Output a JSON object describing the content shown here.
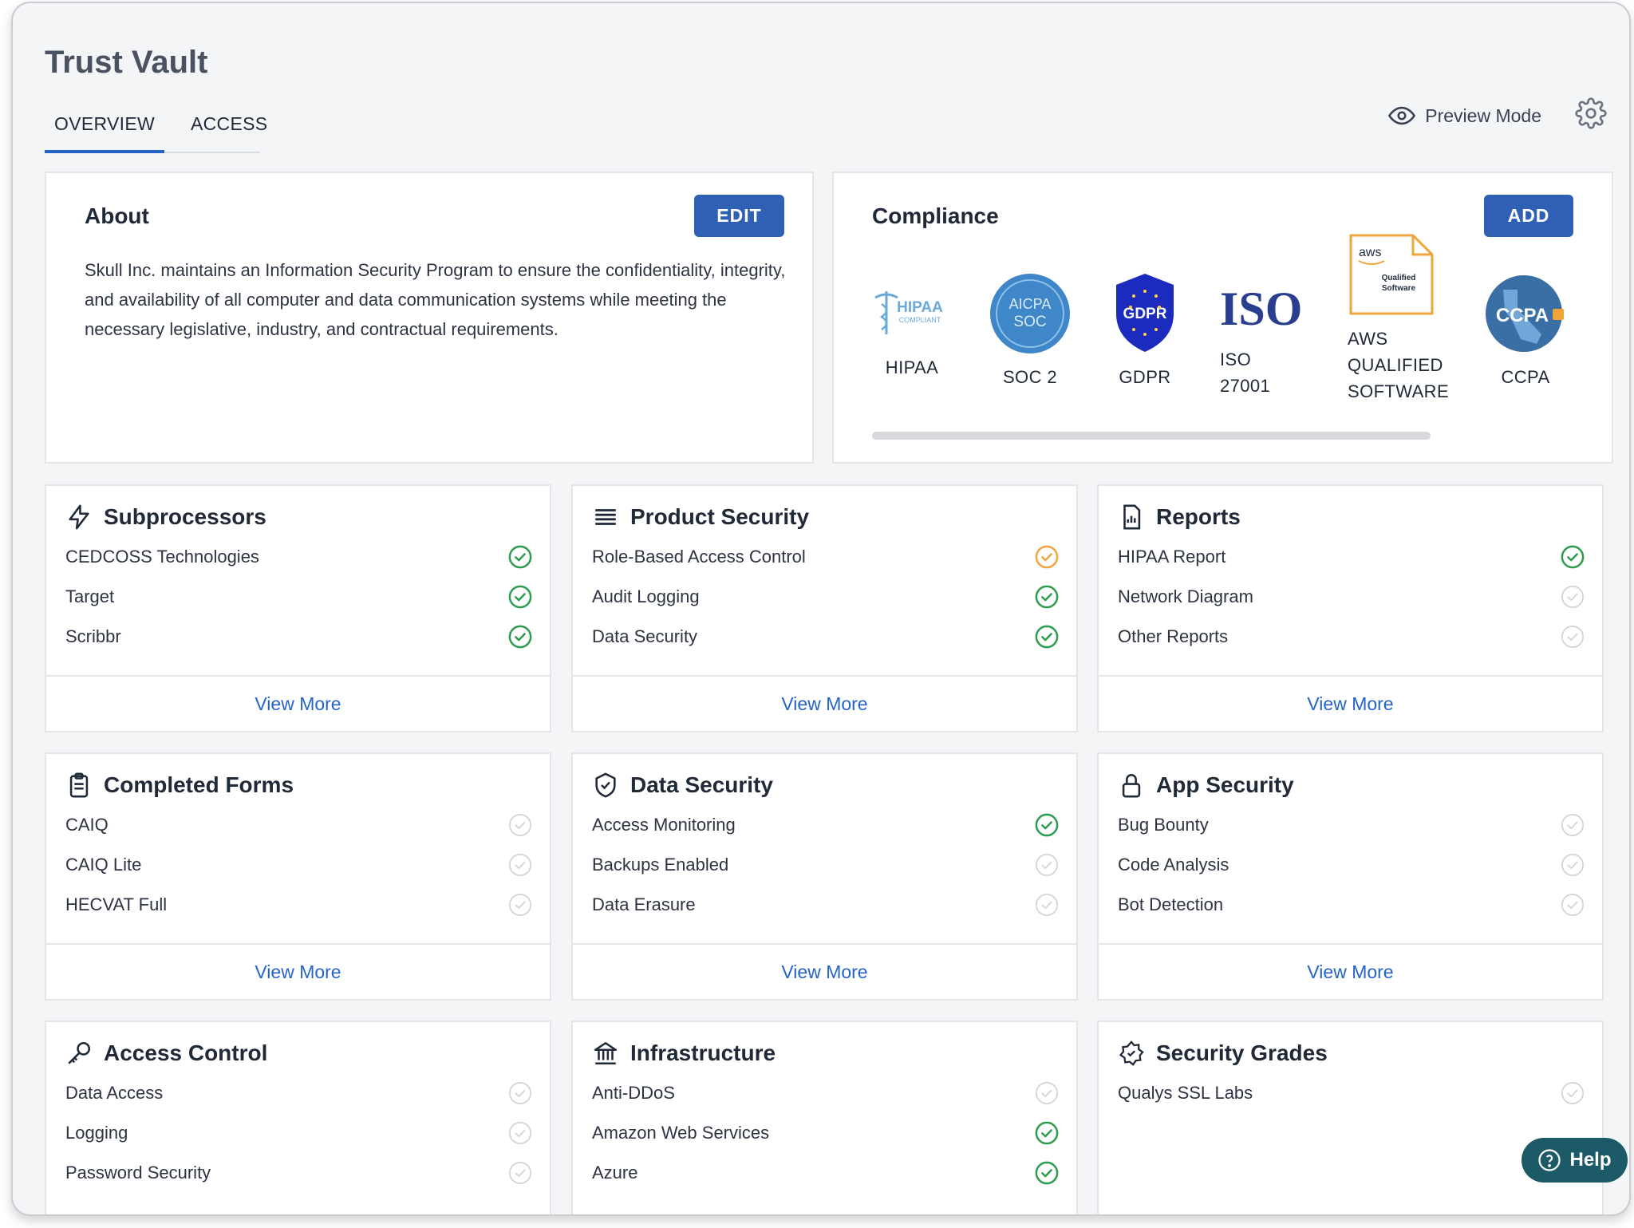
{
  "header": {
    "title": "Trust Vault",
    "tabs": [
      {
        "label": "OVERVIEW"
      },
      {
        "label": "ACCESS"
      }
    ],
    "preview_label": "Preview Mode"
  },
  "about": {
    "title": "About",
    "edit_label": "EDIT",
    "text": "Skull Inc. maintains an Information Security Program to ensure the confidentiality, integrity, and availability of all computer and data communication systems while meeting the necessary legislative, industry, and contractual requirements."
  },
  "compliance": {
    "title": "Compliance",
    "add_label": "ADD",
    "badges": [
      {
        "label": "HIPAA",
        "logo_text": "HIPAA",
        "logo_sub": "COMPLIANT"
      },
      {
        "label": "SOC 2",
        "logo_text": "AICPA",
        "logo_sub": "SOC"
      },
      {
        "label": "GDPR",
        "logo_text": "GDPR"
      },
      {
        "label": "ISO 27001",
        "logo_text": "ISO"
      },
      {
        "label": "AWS QUALIFIED SOFTWARE",
        "logo_text": "aws",
        "logo_sub": "Qualified Software"
      },
      {
        "label": "CCPA",
        "logo_text": "CCPA"
      }
    ]
  },
  "sections": [
    {
      "title": "Subprocessors",
      "icon": "bolt-icon",
      "items": [
        {
          "label": "CEDCOSS Technologies",
          "status": "complete"
        },
        {
          "label": "Target",
          "status": "complete"
        },
        {
          "label": "Scribbr",
          "status": "complete"
        }
      ],
      "view_more": "View More"
    },
    {
      "title": "Product Security",
      "icon": "list-icon",
      "items": [
        {
          "label": "Role-Based Access Control",
          "status": "partial"
        },
        {
          "label": "Audit Logging",
          "status": "complete"
        },
        {
          "label": "Data Security",
          "status": "complete"
        }
      ],
      "view_more": "View More"
    },
    {
      "title": "Reports",
      "icon": "report-icon",
      "items": [
        {
          "label": "HIPAA Report",
          "status": "complete"
        },
        {
          "label": "Network Diagram",
          "status": "none"
        },
        {
          "label": "Other Reports",
          "status": "none"
        }
      ],
      "view_more": "View More"
    },
    {
      "title": "Completed Forms",
      "icon": "clipboard-icon",
      "items": [
        {
          "label": "CAIQ",
          "status": "none"
        },
        {
          "label": "CAIQ Lite",
          "status": "none"
        },
        {
          "label": "HECVAT Full",
          "status": "none"
        }
      ],
      "view_more": "View More"
    },
    {
      "title": "Data Security",
      "icon": "shield-icon",
      "items": [
        {
          "label": "Access Monitoring",
          "status": "complete"
        },
        {
          "label": "Backups Enabled",
          "status": "none"
        },
        {
          "label": "Data Erasure",
          "status": "none"
        }
      ],
      "view_more": "View More"
    },
    {
      "title": "App Security",
      "icon": "lock-icon",
      "items": [
        {
          "label": "Bug Bounty",
          "status": "none"
        },
        {
          "label": "Code Analysis",
          "status": "none"
        },
        {
          "label": "Bot Detection",
          "status": "none"
        }
      ],
      "view_more": "View More"
    },
    {
      "title": "Access Control",
      "icon": "key-icon",
      "items": [
        {
          "label": "Data Access",
          "status": "none"
        },
        {
          "label": "Logging",
          "status": "none"
        },
        {
          "label": "Password Security",
          "status": "none"
        }
      ]
    },
    {
      "title": "Infrastructure",
      "icon": "bank-icon",
      "items": [
        {
          "label": "Anti-DDoS",
          "status": "none"
        },
        {
          "label": "Amazon Web Services",
          "status": "complete"
        },
        {
          "label": "Azure",
          "status": "complete"
        }
      ]
    },
    {
      "title": "Security Grades",
      "icon": "badge-icon",
      "items": [
        {
          "label": "Qualys SSL Labs",
          "status": "none"
        }
      ]
    }
  ],
  "help_label": "Help",
  "colors": {
    "accent": "#2f60b3",
    "complete": "#2e9c4e",
    "partial": "#f0a53a",
    "none": "#d0d3d8",
    "help": "#1c5a68"
  }
}
